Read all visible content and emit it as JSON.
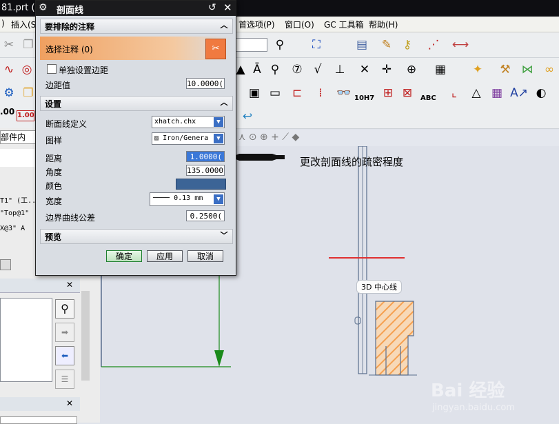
{
  "app": {
    "window_title": "81.prt (",
    "menus": [
      "插入(S)",
      "首选项(P)",
      "窗口(O)",
      "GC 工具箱",
      "帮助(H)"
    ],
    "left_labels": [
      ".00",
      "1.00",
      "部件内"
    ],
    "left_list": [
      "T1\" (工...",
      "\"Top@1\"",
      "X@3\" A"
    ],
    "toolbar_text": [
      "ABC",
      "10H7"
    ]
  },
  "dialog": {
    "title": "剖面线",
    "section_exclude": "要排除的注释",
    "select_annotation": "选择注释 (0)",
    "checkbox_label": "单独设置边距",
    "margin_label": "边距值",
    "margin_value": "10.0000(",
    "section_settings": "设置",
    "def_label": "断面线定义",
    "def_value": "xhatch.chx",
    "pattern_label": "图样",
    "pattern_value": "Iron/Genera",
    "distance_label": "距离",
    "distance_value": "1.0000(",
    "angle_label": "角度",
    "angle_value": "135.0000(",
    "color_label": "颜色",
    "color_hex": "#3c6496",
    "width_label": "宽度",
    "width_value": "0.13 mm",
    "tolerance_label": "边界曲线公差",
    "tolerance_value": "0.2500(",
    "section_preview": "预览",
    "ok": "确定",
    "apply": "应用",
    "cancel": "取消"
  },
  "annotation": {
    "note": "更改剖面线的疏密程度",
    "centerline_tag": "3D 中心线"
  },
  "watermark": {
    "brand": "Bai 经验",
    "url": "jingyan.baidu.com"
  },
  "colors": {
    "accent_orange": "#f0a060",
    "hatch_orange": "#f5a050",
    "green_line": "#1a8a1a",
    "red_line": "#e03030",
    "line_blue": "#5a6e8c"
  }
}
